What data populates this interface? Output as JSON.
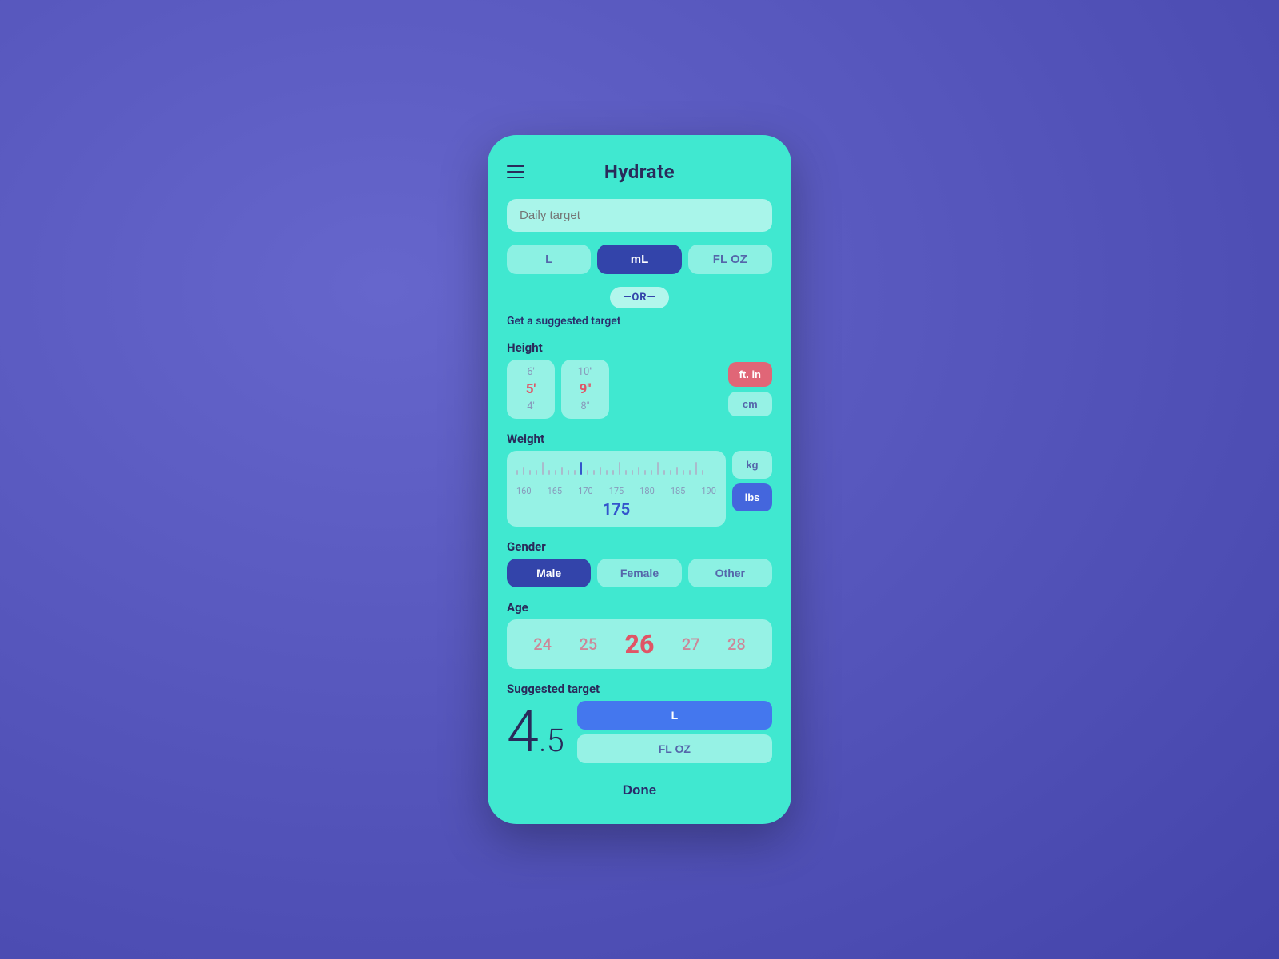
{
  "app": {
    "title": "Hydrate",
    "background_color": "#5555bb"
  },
  "header": {
    "menu_icon_label": "menu",
    "title": "Hydrate"
  },
  "daily_target": {
    "placeholder": "Daily target",
    "value": ""
  },
  "unit_toggle": {
    "options": [
      "L",
      "mL",
      "FL OZ"
    ],
    "active": "mL"
  },
  "or_divider": {
    "label": "—OR—"
  },
  "suggested_prompt": {
    "label": "Get a suggested target"
  },
  "height": {
    "label": "Height",
    "feet_values": [
      "6'",
      "5'",
      "4'"
    ],
    "feet_selected": "5'",
    "inches_values": [
      "10''",
      "9''",
      "8''"
    ],
    "inches_selected": "9''",
    "unit_options": [
      "ft. in",
      "cm"
    ],
    "active_unit": "ft. in"
  },
  "weight": {
    "label": "Weight",
    "values": [
      "160",
      "165",
      "170",
      "175",
      "180",
      "185",
      "190"
    ],
    "selected": "175",
    "unit_options": [
      "kg",
      "lbs"
    ],
    "active_unit": "lbs"
  },
  "gender": {
    "label": "Gender",
    "options": [
      "Male",
      "Female",
      "Other"
    ],
    "active": "Male"
  },
  "age": {
    "label": "Age",
    "values": [
      "24",
      "25",
      "26",
      "27",
      "28"
    ],
    "selected": "26"
  },
  "suggested_target": {
    "label": "Suggested target",
    "value_integer": "4",
    "value_decimal": ".5",
    "unit_options": [
      "L",
      "FL OZ"
    ],
    "active_unit": "L"
  },
  "done_button": {
    "label": "Done"
  }
}
